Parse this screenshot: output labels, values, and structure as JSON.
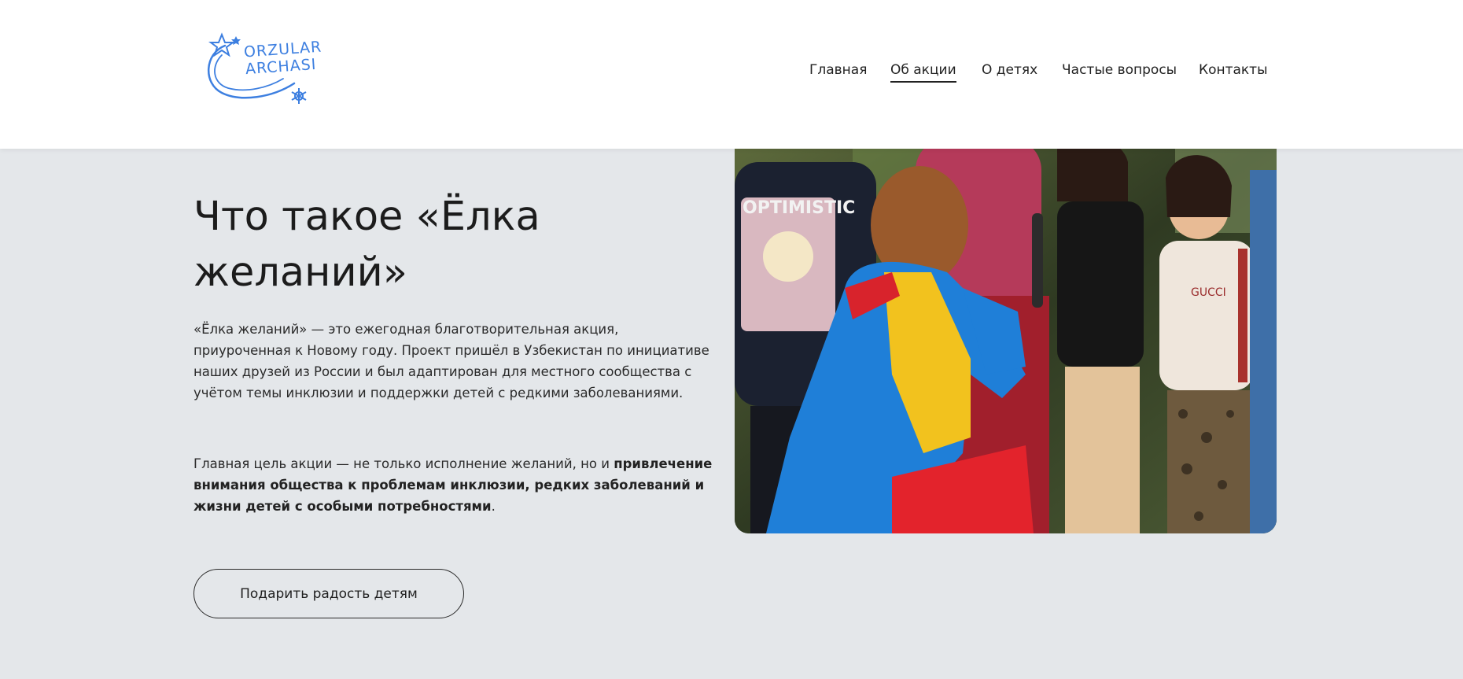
{
  "header": {
    "logo": {
      "line1": "ORZULAR",
      "line2": "ARCHASI",
      "icon": "star-swirl-logo"
    },
    "nav": [
      {
        "label": "Главная",
        "active": false
      },
      {
        "label": "Об акции",
        "active": true
      },
      {
        "label": "О детях",
        "active": false
      },
      {
        "label": "Частые вопросы",
        "active": false
      },
      {
        "label": "Контакты",
        "active": false
      }
    ]
  },
  "main": {
    "title": "Что такое «Ёлка желаний»",
    "paragraph1": "«Ёлка желаний» — это ежегодная благотворительная акция, приуроченная к Новому году. Проект пришёл в Узбекистан по инициативе наших друзей из России и был адаптирован для местного сообщества с учётом темы инклюзии и поддержки детей с редкими заболеваниями.",
    "paragraph2_plain": "Главная цель акции — не только исполнение желаний, но и ",
    "paragraph2_bold": "привлечение внимания общества к проблемам инклюзии, редких заболеваний и жизни детей с особыми потребностями",
    "paragraph2_end": ".",
    "cta_label": "Подарить радость детям"
  },
  "photo": {
    "shirt_text": "OPTIMISTIC",
    "hoodie_text": "GUCCI"
  },
  "colors": {
    "background": "#e4e7ea",
    "header_bg": "#ffffff",
    "logo_blue": "#3d7fe0",
    "text": "#1f1f1f"
  }
}
